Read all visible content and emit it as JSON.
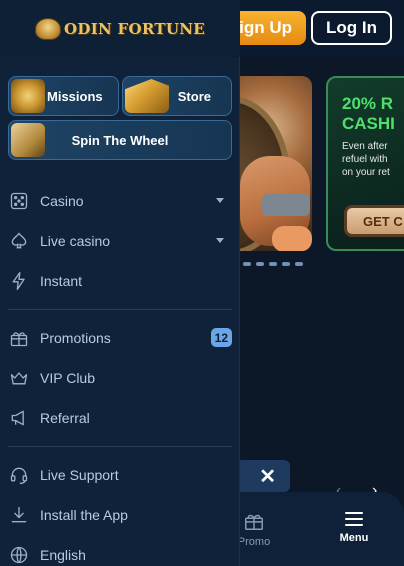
{
  "header": {
    "logo_text": "ODIN FORTUNE",
    "signup_label": "Sign Up",
    "login_label": "Log In"
  },
  "promo_card": {
    "title_line1": "20% R",
    "title_line2": "CASHI",
    "body_lines": [
      "Even after",
      "refuel with",
      "on your ret"
    ],
    "cta_label": "GET C"
  },
  "drawer": {
    "tiles": {
      "missions": "Missions",
      "store": "Store",
      "spin": "Spin The Wheel"
    },
    "items": [
      {
        "label": "Casino",
        "icon": "dice-icon",
        "has_caret": true
      },
      {
        "label": "Live casino",
        "icon": "card-suit-icon",
        "has_caret": true
      },
      {
        "label": "Instant",
        "icon": "lightning-icon",
        "has_caret": false
      },
      {
        "label": "Promotions",
        "icon": "gift-icon",
        "badge": "12"
      },
      {
        "label": "VIP Club",
        "icon": "crown-icon"
      },
      {
        "label": "Referral",
        "icon": "megaphone-icon"
      },
      {
        "label": "Live Support",
        "icon": "headset-icon"
      },
      {
        "label": "Install the App",
        "icon": "download-icon"
      },
      {
        "label": "English",
        "icon": "globe-icon"
      }
    ]
  },
  "bottom_nav": {
    "promo_label": "Promo",
    "menu_label": "Menu"
  },
  "toast": {
    "close_glyph": "✕"
  },
  "colors": {
    "accent_orange": "#e68a12",
    "promo_green": "#4fe06c",
    "badge_blue": "#6aa6e8",
    "drawer_bg": "#10223a"
  }
}
